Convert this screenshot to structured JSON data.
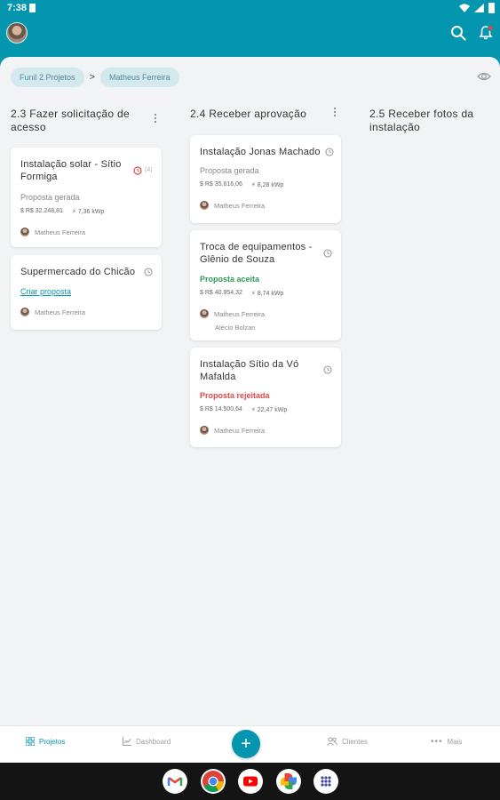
{
  "status_bar": {
    "time": "7:38"
  },
  "breadcrumb": {
    "items": [
      "Funil 2 Projetos",
      "Matheus Ferreira"
    ],
    "separator": ">"
  },
  "columns": [
    {
      "title_line1": "2.3 Fazer solicitação de",
      "title_line2": "acesso",
      "cards": [
        {
          "title_line1": "Instalação solar - Sítio",
          "title_line2": "Formiga",
          "badge": "(4)",
          "status": "Proposta gerada",
          "value": "$ R$ 32.248,81",
          "power": "7,36 kWp",
          "person": "Matheus Ferreira"
        },
        {
          "title_line1": "Supermercado do Chicão",
          "status": "Criar proposta",
          "person": "Matheus Ferreira"
        }
      ]
    },
    {
      "title_line1": "2.4 Receber aprovação",
      "cards": [
        {
          "title_line1": "Instalação Jonas Machado",
          "status": "Proposta gerada",
          "value": "$ R$ 35.616,06",
          "power": "8,28 kWp",
          "person": "Matheus Ferreira"
        },
        {
          "title_line1": "Troca de equipamentos -",
          "title_line2": "Glênio de Souza",
          "status": "Proposta aceita",
          "value": "$ R$ 40.954,32",
          "power": "8,74 kWp",
          "person": "Matheus Ferreira",
          "person2": "Alécio Bolzan"
        },
        {
          "title_line1": "Instalação Sítio da Vó",
          "title_line2": "Mafalda",
          "status": "Proposta rejeitada",
          "value": "$ R$ 14.500,64",
          "power": "22,47 kWp",
          "person": "Matheus Ferreira"
        }
      ]
    },
    {
      "title_line1": "2.5 Receber fotos da",
      "title_line2": "instalação",
      "cards": []
    }
  ],
  "bottom_nav": {
    "projetos": "Projetos",
    "dashboard": "Dashboard",
    "add": "+",
    "clientes": "Clientes",
    "mais": "Mais"
  },
  "colors": {
    "primary": "#0396ae",
    "accepted": "#2d9a5a",
    "rejected": "#e04848",
    "background": "#f2f3f5"
  },
  "icons": {
    "top": [
      "avatar",
      "search-icon",
      "bell-icon",
      "eye-icon"
    ],
    "dock": [
      "gmail-icon",
      "chrome-icon",
      "youtube-icon",
      "photos-icon",
      "apps-icon"
    ]
  }
}
